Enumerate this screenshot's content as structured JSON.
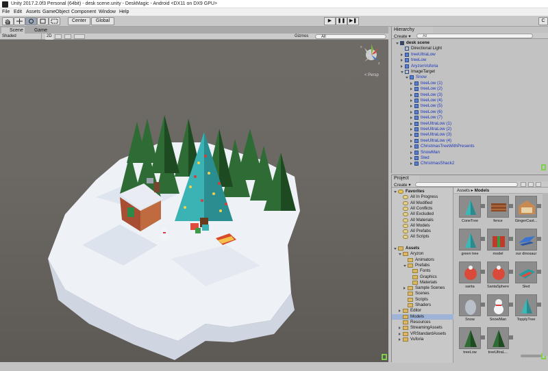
{
  "window": {
    "title": "Unity 2017.2.0f3 Personal (64bit) - desk scene.unity - DeskMagic - Android <DX11 on DX9 GPU>"
  },
  "menu": [
    "File",
    "Edit",
    "Assets",
    "GameObject",
    "Component",
    "Window",
    "Help"
  ],
  "toolbar": {
    "pivot": "Center",
    "space": "Global",
    "play": "▶",
    "pause": "❚❚",
    "step": "▶❚",
    "right_edge": "C"
  },
  "scene": {
    "tabs": [
      "Scene",
      "Game"
    ],
    "shading": "Shaded",
    "mode_2d": "2D",
    "gizmos": "Gizmos",
    "search_placeholder": "All",
    "persp": "< Persp",
    "gizmo_x": "x",
    "gizmo_z": "z"
  },
  "hierarchy": {
    "tab": "Hierarchy",
    "create": "Create ▾",
    "search_placeholder": "All",
    "rows": [
      {
        "label": "desk scene",
        "depth": 0,
        "color": "black",
        "arrow": "down"
      },
      {
        "label": "Directional Light",
        "depth": 1,
        "color": "black",
        "arrow": "none"
      },
      {
        "label": "treeUltraLow",
        "depth": 1,
        "color": "blue",
        "arrow": "right"
      },
      {
        "label": "treeLow",
        "depth": 1,
        "color": "blue",
        "arrow": "right"
      },
      {
        "label": "AryzonVuforia",
        "depth": 1,
        "color": "blue",
        "arrow": "right"
      },
      {
        "label": "ImageTarget",
        "depth": 1,
        "color": "black",
        "arrow": "down"
      },
      {
        "label": "Snow",
        "depth": 2,
        "color": "blue",
        "arrow": "down"
      },
      {
        "label": "treeLow (1)",
        "depth": 3,
        "color": "blue",
        "arrow": "right"
      },
      {
        "label": "treeLow (2)",
        "depth": 3,
        "color": "blue",
        "arrow": "right"
      },
      {
        "label": "treeLow (3)",
        "depth": 3,
        "color": "blue",
        "arrow": "right"
      },
      {
        "label": "treeLow (4)",
        "depth": 3,
        "color": "blue",
        "arrow": "right"
      },
      {
        "label": "treeLow (5)",
        "depth": 3,
        "color": "blue",
        "arrow": "right"
      },
      {
        "label": "treeLow (6)",
        "depth": 3,
        "color": "blue",
        "arrow": "right"
      },
      {
        "label": "treeLow (7)",
        "depth": 3,
        "color": "blue",
        "arrow": "right"
      },
      {
        "label": "treeUltraLow (1)",
        "depth": 3,
        "color": "blue",
        "arrow": "right"
      },
      {
        "label": "treeUltraLow (2)",
        "depth": 3,
        "color": "blue",
        "arrow": "right"
      },
      {
        "label": "treeUltraLow (3)",
        "depth": 3,
        "color": "blue",
        "arrow": "right"
      },
      {
        "label": "treeUltraLow (4)",
        "depth": 3,
        "color": "blue",
        "arrow": "right"
      },
      {
        "label": "ChristmasTreeWithPresents",
        "depth": 3,
        "color": "blue",
        "arrow": "right"
      },
      {
        "label": "SnowMan",
        "depth": 3,
        "color": "blue",
        "arrow": "right"
      },
      {
        "label": "Sled",
        "depth": 3,
        "color": "blue",
        "arrow": "right"
      },
      {
        "label": "ChristmasShack2",
        "depth": 3,
        "color": "blue",
        "arrow": "right"
      }
    ]
  },
  "project": {
    "tab": "Project",
    "create": "Create ▾",
    "breadcrumb_root": "Assets",
    "breadcrumb_sep": "▸",
    "breadcrumb_leaf": "Models",
    "tree": [
      {
        "label": "Favorites",
        "depth": 0,
        "bold": true,
        "arrow": "down",
        "icon": "star"
      },
      {
        "label": "All In Progress",
        "depth": 1,
        "icon": "search"
      },
      {
        "label": "All Modified",
        "depth": 1,
        "icon": "search"
      },
      {
        "label": "All Conflicts",
        "depth": 1,
        "icon": "search"
      },
      {
        "label": "All Excluded",
        "depth": 1,
        "icon": "search"
      },
      {
        "label": "All Materials",
        "depth": 1,
        "icon": "search"
      },
      {
        "label": "All Models",
        "depth": 1,
        "icon": "search"
      },
      {
        "label": "All Prefabs",
        "depth": 1,
        "icon": "search"
      },
      {
        "label": "All Scripts",
        "depth": 1,
        "icon": "search"
      },
      {
        "label": "",
        "depth": 0,
        "icon": "none"
      },
      {
        "label": "Assets",
        "depth": 0,
        "bold": true,
        "arrow": "down",
        "icon": "folder"
      },
      {
        "label": "Aryzon",
        "depth": 1,
        "arrow": "down",
        "icon": "folder"
      },
      {
        "label": "Animators",
        "depth": 2,
        "icon": "folder"
      },
      {
        "label": "Prefabs",
        "depth": 2,
        "arrow": "down",
        "icon": "folder"
      },
      {
        "label": "Fonts",
        "depth": 3,
        "icon": "folder"
      },
      {
        "label": "Graphics",
        "depth": 3,
        "icon": "folder"
      },
      {
        "label": "Materials",
        "depth": 3,
        "icon": "folder"
      },
      {
        "label": "Sample Scenes",
        "depth": 2,
        "arrow": "right",
        "icon": "folder"
      },
      {
        "label": "Scenes",
        "depth": 2,
        "icon": "folder"
      },
      {
        "label": "Scripts",
        "depth": 2,
        "icon": "folder"
      },
      {
        "label": "Shaders",
        "depth": 2,
        "icon": "folder"
      },
      {
        "label": "Editor",
        "depth": 1,
        "arrow": "right",
        "icon": "folder"
      },
      {
        "label": "Models",
        "depth": 1,
        "icon": "folder",
        "selected": true
      },
      {
        "label": "Resources",
        "depth": 1,
        "icon": "folder"
      },
      {
        "label": "StreamingAssets",
        "depth": 1,
        "arrow": "right",
        "icon": "folder"
      },
      {
        "label": "VRStandardAssets",
        "depth": 1,
        "arrow": "right",
        "icon": "folder"
      },
      {
        "label": "Vuforia",
        "depth": 1,
        "arrow": "right",
        "icon": "folder"
      }
    ],
    "assets": [
      {
        "label": "ConeTree",
        "kind": "cone"
      },
      {
        "label": "fence",
        "kind": "fence"
      },
      {
        "label": "GingerCast...",
        "kind": "house"
      },
      {
        "label": "green tree",
        "kind": "cone"
      },
      {
        "label": "model",
        "kind": "gift"
      },
      {
        "label": "our dinosaur",
        "kind": "sled"
      },
      {
        "label": "santa",
        "kind": "ball"
      },
      {
        "label": "SantaSphere",
        "kind": "ball"
      },
      {
        "label": "Sled",
        "kind": "sled2"
      },
      {
        "label": "Snow",
        "kind": "snow"
      },
      {
        "label": "SnowMan",
        "kind": "snowman"
      },
      {
        "label": "TopplyTree",
        "kind": "cone"
      },
      {
        "label": "treeLow",
        "kind": "pine"
      },
      {
        "label": "treeUltraL...",
        "kind": "pine"
      }
    ]
  }
}
